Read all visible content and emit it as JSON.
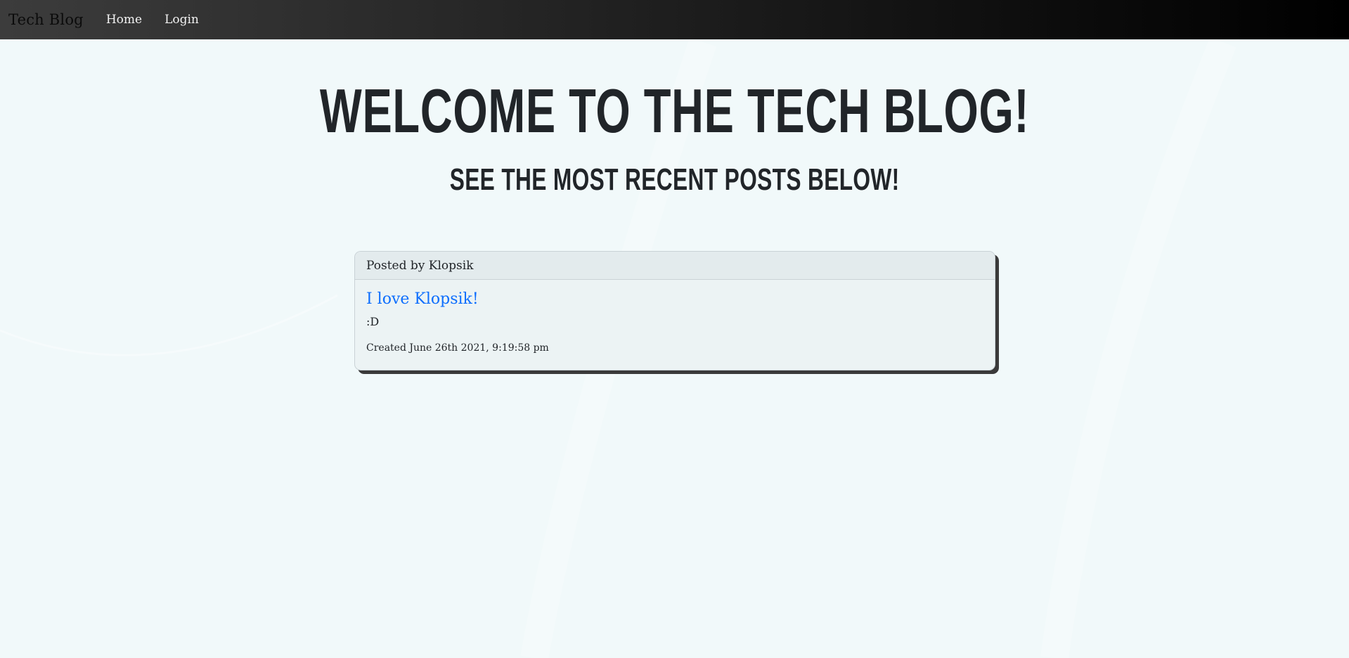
{
  "navbar": {
    "brand": "Tech Blog",
    "links": [
      {
        "label": "Home"
      },
      {
        "label": "Login"
      }
    ]
  },
  "hero": {
    "title": "WELCOME TO THE TECH BLOG!",
    "subtitle": "SEE THE MOST RECENT POSTS BELOW!"
  },
  "posts": [
    {
      "author_line": "Posted by Klopsik",
      "title": "I love Klopsik!",
      "content": ":D",
      "created": "Created June 26th 2021, 9:19:58 pm"
    }
  ],
  "colors": {
    "background": "#f1f9fa",
    "link": "#0d6efd",
    "text": "#212529",
    "card_shadow": "#3a3a3a"
  }
}
